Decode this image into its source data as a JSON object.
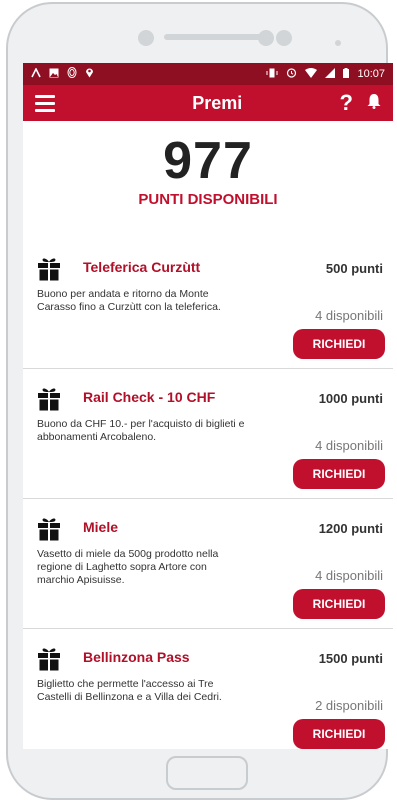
{
  "status_bar": {
    "time": "10:07",
    "icons_left": [
      "navigation-icon",
      "image-icon",
      "fingerprint-icon",
      "location-icon"
    ],
    "icons_right": [
      "vibrate-icon",
      "alarm-icon",
      "wifi-icon",
      "signal-icon",
      "battery-icon"
    ]
  },
  "appbar": {
    "title": "Premi"
  },
  "points": {
    "value": "977",
    "label": "PUNTI DISPONIBILI"
  },
  "rewards": [
    {
      "title": "Teleferica Curzùtt",
      "points": "500 punti",
      "description": "Buono per andata e ritorno da Monte Carasso fino a Curzùtt con la teleferica.",
      "availability": "4 disponibili",
      "button": "RICHIEDI"
    },
    {
      "title": "Rail Check - 10 CHF",
      "points": "1000 punti",
      "description": "Buono da CHF 10.- per l'acquisto di biglieti e abbonamenti Arcobaleno.",
      "availability": "4 disponibili",
      "button": "RICHIEDI"
    },
    {
      "title": "Miele",
      "points": "1200 punti",
      "description": "Vasetto di miele da 500g prodotto nella regione di Laghetto sopra Artore con marchio Apisuisse.",
      "availability": "4 disponibili",
      "button": "RICHIEDI"
    },
    {
      "title": "Bellinzona Pass",
      "points": "1500 punti",
      "description": "Biglietto che permette l'accesso ai Tre Castelli di Bellinzona e a Villa dei Cedri.",
      "availability": "2 disponibili",
      "button": "RICHIEDI"
    }
  ],
  "colors": {
    "primary": "#c0102e",
    "status_bar": "#8e0f22",
    "title_red": "#b01028"
  }
}
